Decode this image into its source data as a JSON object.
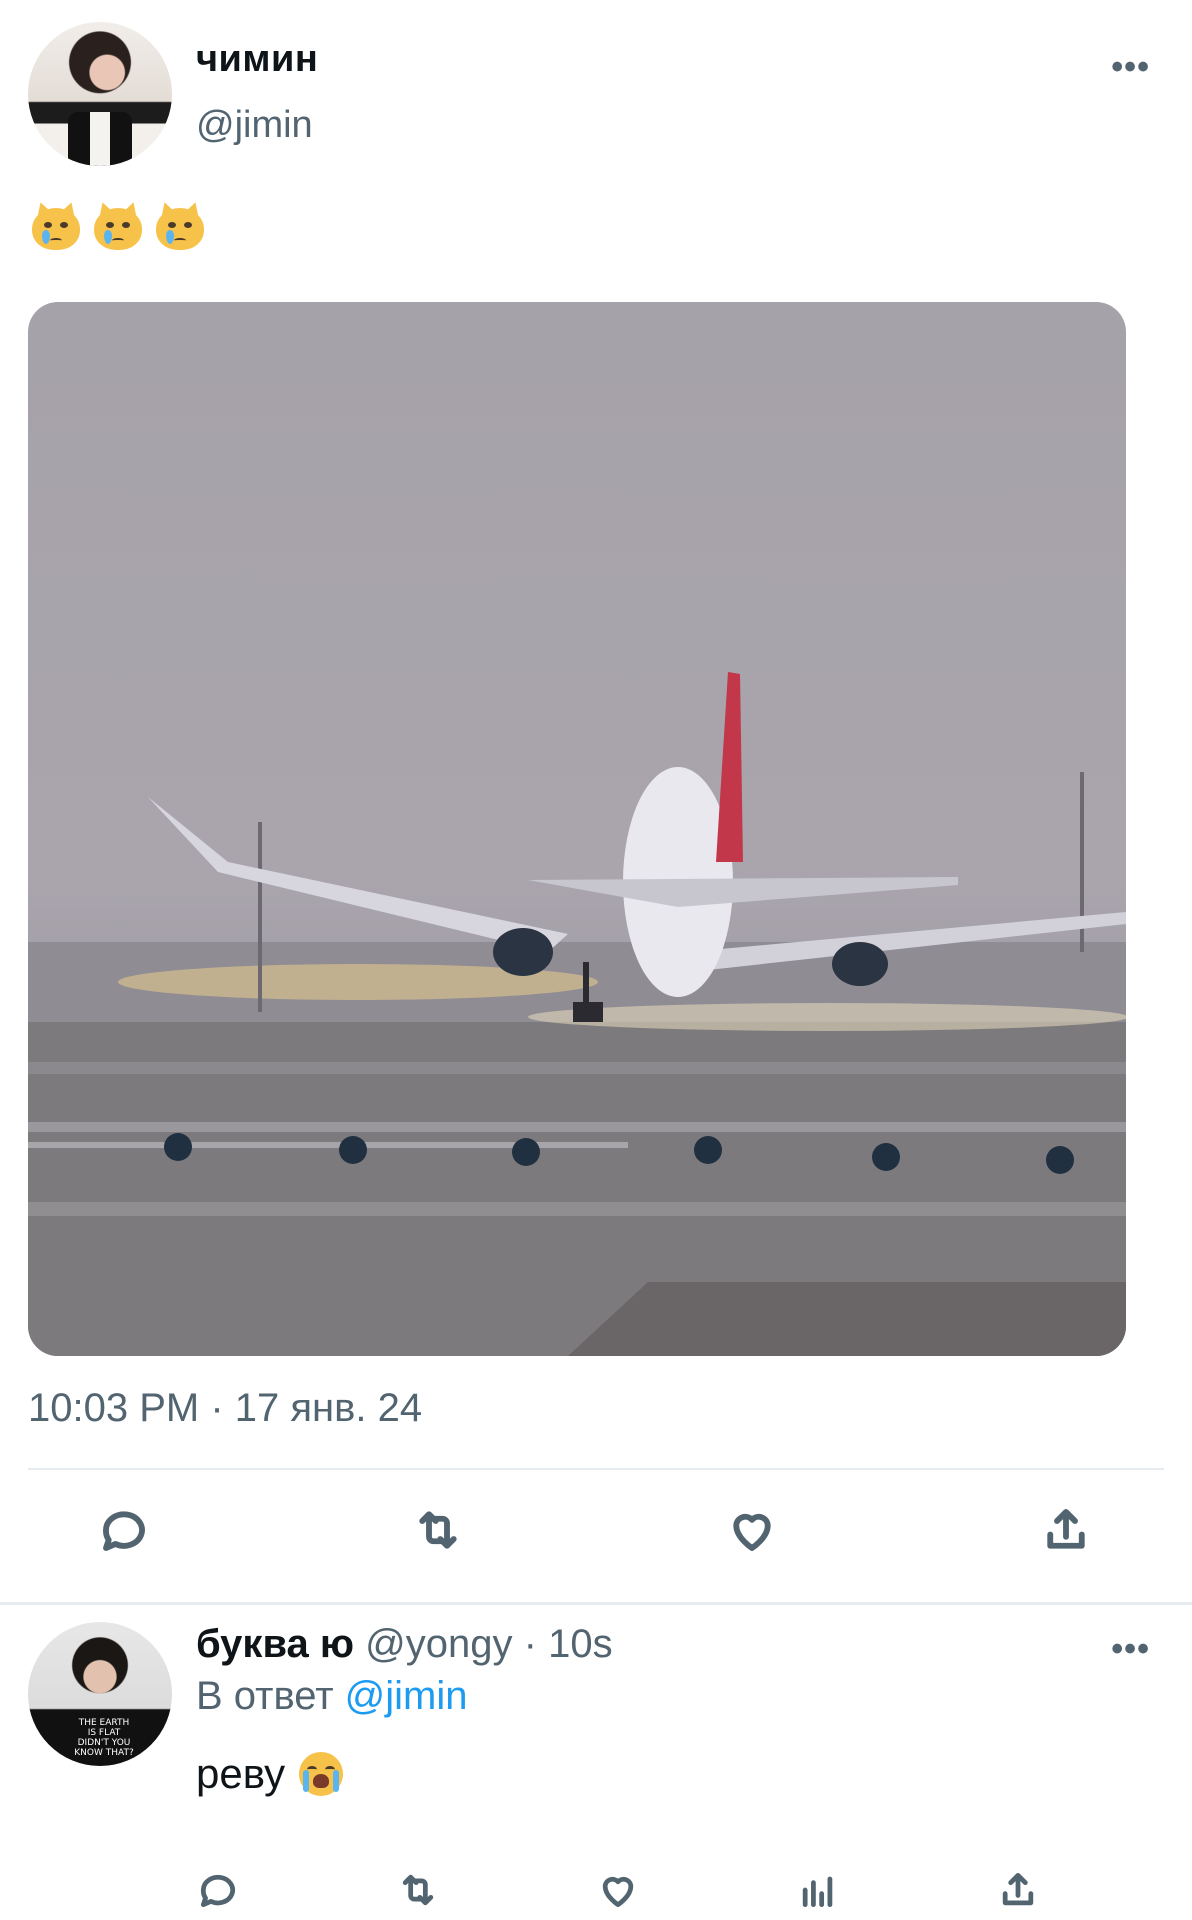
{
  "tweet": {
    "display_name": "чимин",
    "handle": "@jimin",
    "more": "•••",
    "emojis": [
      "crying-cat-face",
      "crying-cat-face",
      "crying-cat-face"
    ],
    "media": "airplane landing on runway",
    "timestamp": "10:03 PM · 17 янв. 24",
    "actions": [
      "reply-icon",
      "retweet-icon",
      "like-icon",
      "share-icon"
    ]
  },
  "reply": {
    "display_name": "буква ю",
    "handle": "@yongy",
    "dot": "·",
    "time": "10s",
    "reply_to_prefix": "В ответ",
    "reply_to_mention": "@jimin",
    "text": "реву",
    "emoji": "loudly-crying-face",
    "avatar_shirt_text": "THE EARTH IS FLAT DIDN'T YOU KNOW THAT?",
    "more": "•••",
    "actions": [
      "reply-icon",
      "retweet-icon",
      "like-icon",
      "views-icon",
      "share-icon"
    ]
  },
  "colors": {
    "text_primary": "#0f1419",
    "text_secondary": "#536471",
    "link": "#1d9bf0",
    "divider": "#e6ecf0"
  }
}
